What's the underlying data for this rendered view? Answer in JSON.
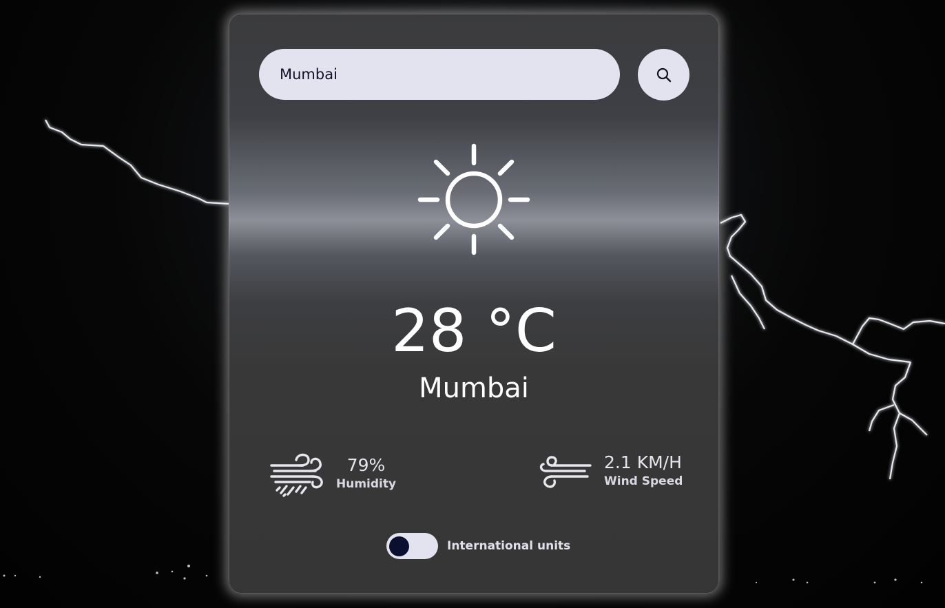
{
  "search": {
    "value": "Mumbai",
    "icon": "search-icon"
  },
  "weather": {
    "condition_icon": "sun-icon",
    "temperature": "28 °C",
    "city": "Mumbai"
  },
  "metrics": {
    "humidity": {
      "value": "79%",
      "label": "Humidity",
      "icon": "humidity-icon"
    },
    "wind": {
      "value": "2.1 KM/H",
      "label": "Wind Speed",
      "icon": "wind-icon"
    }
  },
  "units": {
    "label": "International units",
    "toggle_on": false
  },
  "colors": {
    "input_bg": "#e3e3ef",
    "knob": "#0b1030",
    "card_text": "#ffffff"
  }
}
